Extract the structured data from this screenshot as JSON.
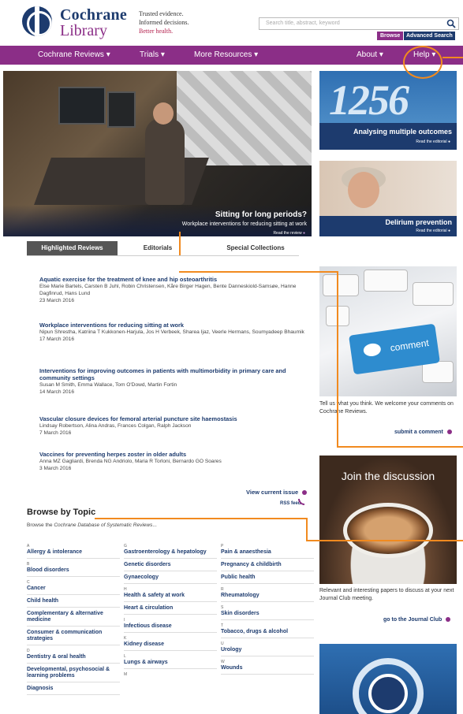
{
  "brand": {
    "name_line1": "Cochrane",
    "name_line2": "Library",
    "tagline_1": "Trusted evidence.",
    "tagline_2": "Informed decisions.",
    "tagline_3": "Better health."
  },
  "search": {
    "placeholder": "Search title, abstract, keyword",
    "browse_label": "Browse",
    "advanced_label": "Advanced Search"
  },
  "nav": {
    "reviews": "Cochrane Reviews ▾",
    "trials": "Trials ▾",
    "more": "More Resources ▾",
    "about": "About ▾",
    "help": "Help ▾"
  },
  "hero": {
    "title": "Sitting for long periods?",
    "subtitle": "Workplace interventions for reducing sitting at work",
    "link": "Read the review"
  },
  "side_cards": [
    {
      "title": "Analysing multiple outcomes",
      "link": "Read the editorial"
    },
    {
      "title": "Delirium prevention",
      "link": "Read the editorial"
    }
  ],
  "tabs": [
    "Highlighted Reviews",
    "Editorials",
    "Special Collections"
  ],
  "articles": [
    {
      "title": "Aquatic exercise for the treatment of knee and hip osteoarthritis",
      "authors": "Else Marie Bartels, Carsten B Juhl, Robin Christensen, Kåre Birger Hagen, Bente Danneskiold-Samsøe, Hanne Dagfinrud, Hans Lund",
      "date": "23 March 2016"
    },
    {
      "title": "Workplace interventions for reducing sitting at work",
      "authors": "Nipun Shrestha, Katriina T Kukkonen-Harjula, Jos H Verbeek, Sharea Ijaz, Veerle Hermans, Soumyadeep Bhaumik",
      "date": "17 March 2016"
    },
    {
      "title": "Interventions for improving outcomes in patients with multimorbidity in primary care and community settings",
      "authors": "Susan M Smith, Emma Wallace, Tom O'Dowd, Martin Fortin",
      "date": "14 March 2016"
    },
    {
      "title": "Vascular closure devices for femoral arterial puncture site haemostasis",
      "authors": "Lindsay Robertson, Alina Andras, Frances Colgan, Ralph Jackson",
      "date": "7 March 2016"
    },
    {
      "title": "Vaccines for preventing herpes zoster in older adults",
      "authors": "Anna MZ Gagliardi, Brenda NG Andriolo, Maria R Torloni, Bernardo GO Soares",
      "date": "3 March 2016"
    }
  ],
  "view_issue": "View current issue",
  "rss": "RSS feed",
  "browse_topic": {
    "heading": "Browse by Topic",
    "sub_prefix": "Browse the ",
    "sub_italic": "Cochrane Database of Systematic Reviews",
    "sub_suffix": "..."
  },
  "topics": {
    "col1": [
      {
        "letter": "A",
        "items": [
          "Allergy & intolerance"
        ]
      },
      {
        "letter": "B",
        "items": [
          "Blood disorders"
        ]
      },
      {
        "letter": "C",
        "items": [
          "Cancer",
          "Child health",
          "Complementary & alternative medicine",
          "Consumer & communication strategies"
        ]
      },
      {
        "letter": "D",
        "items": [
          "Dentistry & oral health",
          "Developmental, psychosocial & learning problems",
          "Diagnosis"
        ]
      }
    ],
    "col2": [
      {
        "letter": "G",
        "items": [
          "Gastroenterology & hepatology",
          "Genetic disorders",
          "Gynaecology"
        ]
      },
      {
        "letter": "H",
        "items": [
          "Health & safety at work",
          "Heart & circulation"
        ]
      },
      {
        "letter": "I",
        "items": [
          "Infectious disease"
        ]
      },
      {
        "letter": "K",
        "items": [
          "Kidney disease"
        ]
      },
      {
        "letter": "L",
        "items": [
          "Lungs & airways"
        ]
      },
      {
        "letter": "M",
        "items": []
      }
    ],
    "col3": [
      {
        "letter": "P",
        "items": [
          "Pain & anaesthesia",
          "Pregnancy & childbirth",
          "Public health"
        ]
      },
      {
        "letter": "R",
        "items": [
          "Rheumatology"
        ]
      },
      {
        "letter": "S",
        "items": [
          "Skin disorders"
        ]
      },
      {
        "letter": "T",
        "items": [
          "Tobacco, drugs & alcohol"
        ]
      },
      {
        "letter": "U",
        "items": [
          "Urology"
        ]
      },
      {
        "letter": "W",
        "items": [
          "Wounds"
        ]
      }
    ]
  },
  "comment": {
    "key_text": "comment",
    "text": "Tell us what you think. We welcome your comments on Cochrane Reviews.",
    "link": "submit a comment"
  },
  "journal_club": {
    "heading": "Join the discussion",
    "text": "Relevant and interesting papers to discuss at your next Journal Club meeting.",
    "link": "go to the Journal Club"
  },
  "colors": {
    "brand_purple": "#8b2e87",
    "brand_navy": "#1d3b6e",
    "annotation_orange": "#f18a1f"
  }
}
